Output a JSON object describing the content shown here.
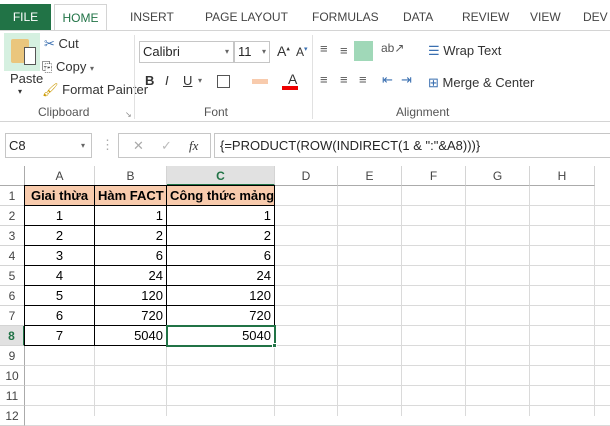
{
  "tabs": [
    "FILE",
    "HOME",
    "INSERT",
    "PAGE LAYOUT",
    "FORMULAS",
    "DATA",
    "REVIEW",
    "VIEW",
    "DEV"
  ],
  "clipboard": {
    "paste": "Paste",
    "cut": "Cut",
    "copy": "Copy",
    "format_painter": "Format Painter",
    "group": "Clipboard"
  },
  "font": {
    "name": "Calibri",
    "size": "11",
    "bold": "B",
    "italic": "I",
    "underline": "U",
    "font_color": "A",
    "group": "Font"
  },
  "alignment": {
    "wrap_text": "Wrap Text",
    "merge_center": "Merge & Center",
    "group": "Alignment"
  },
  "formula_bar": {
    "name_box": "C8",
    "fx": "fx",
    "formula": "{=PRODUCT(ROW(INDIRECT(1 & \":\"&A8)))}"
  },
  "columns": [
    "A",
    "B",
    "C",
    "D",
    "E",
    "F",
    "G",
    "H"
  ],
  "rows": [
    "1",
    "2",
    "3",
    "4",
    "5",
    "6",
    "7",
    "8",
    "9",
    "10",
    "11",
    "12"
  ],
  "headers": [
    "Giai thừa",
    "Hàm FACT",
    "Công thức mảng"
  ],
  "data": [
    [
      "1",
      "1",
      "1"
    ],
    [
      "2",
      "2",
      "2"
    ],
    [
      "3",
      "6",
      "6"
    ],
    [
      "4",
      "24",
      "24"
    ],
    [
      "5",
      "120",
      "120"
    ],
    [
      "6",
      "720",
      "720"
    ],
    [
      "7",
      "5040",
      "5040"
    ]
  ],
  "colors": {
    "accent": "#217346",
    "header_fill": "#f8cbad"
  }
}
